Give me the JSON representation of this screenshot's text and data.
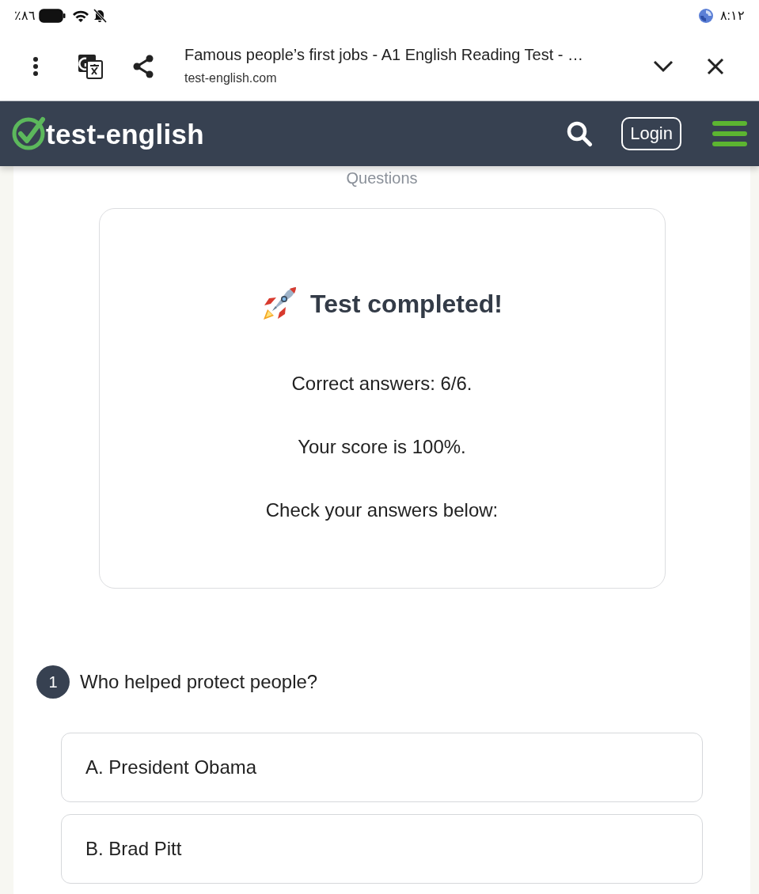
{
  "status_bar": {
    "battery": "٪۸٦",
    "time": "۸:۱۲"
  },
  "browser_bar": {
    "title": "Famous people’s first jobs - A1 English Reading Test - …",
    "url": "test-english.com"
  },
  "navbar": {
    "logo": "test-english",
    "login": "Login"
  },
  "section_heading": "Questions",
  "result": {
    "title": "Test completed!",
    "lines": [
      "Correct answers: 6/6.",
      "Your score is 100%.",
      "Check your answers below:"
    ]
  },
  "questions": [
    {
      "number": "1",
      "text": "Who helped protect people?",
      "options": [
        "A. President Obama",
        "B. Brad Pitt"
      ]
    }
  ]
}
